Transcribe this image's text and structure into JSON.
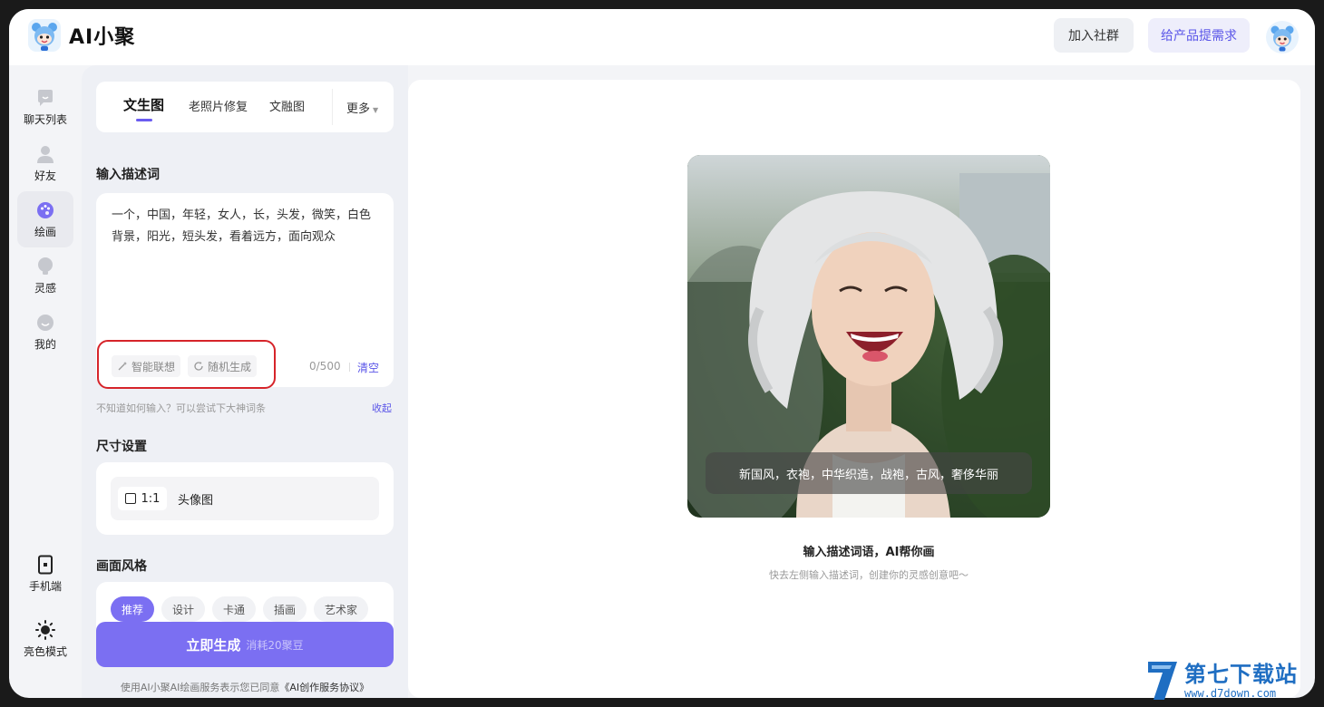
{
  "header": {
    "app_name": "AI小聚",
    "join_group_label": "加入社群",
    "feedback_label": "给产品提需求"
  },
  "nav": {
    "items": [
      {
        "label": "聊天列表",
        "icon": "chat-bubble-icon"
      },
      {
        "label": "好友",
        "icon": "user-icon"
      },
      {
        "label": "绘画",
        "icon": "palette-icon",
        "active": true
      },
      {
        "label": "灵感",
        "icon": "lightbulb-icon"
      },
      {
        "label": "我的",
        "icon": "smile-icon"
      }
    ],
    "mobile_label": "手机端",
    "theme_label": "亮色模式"
  },
  "panel": {
    "tabs": [
      "文生图",
      "老照片修复",
      "文融图"
    ],
    "active_tab": "文生图",
    "more_label": "更多",
    "prompt_section_title": "输入描述词",
    "prompt_text": "一个，中国，年轻，女人，长，头发，微笑，白色背景，阳光，短头发，看着远方，面向观众",
    "smart_assist_label": "智能联想",
    "random_label": "随机生成",
    "char_count": "0/500",
    "clear_label": "清空",
    "hint_text": "不知道如何输入？可以尝试下大神词条",
    "collapse_label": "收起",
    "size_section_title": "尺寸设置",
    "size_ratio": "1:1",
    "size_label": "头像图",
    "style_section_title": "画面风格",
    "style_options": [
      "推荐",
      "设计",
      "卡通",
      "插画",
      "艺术家"
    ],
    "generate_label": "立即生成",
    "generate_cost": "消耗20聚豆",
    "agreement_prefix": "使用AI小聚AI绘画服务表示您已同意",
    "agreement_link": "《AI创作服务协议》"
  },
  "main": {
    "preview_caption": "新国风，衣袍，中华织造，战袍，古风，奢侈华丽",
    "empty_title": "输入描述词语，AI帮你画",
    "empty_subtitle": "快去左侧输入描述词，创建你的灵感创意吧～"
  },
  "watermark": {
    "site_name": "第七下载站",
    "url": "www.d7down.com"
  },
  "colors": {
    "accent": "#7b6ff2",
    "link": "#5a55e8",
    "highlight_annotation": "#d6242a"
  }
}
